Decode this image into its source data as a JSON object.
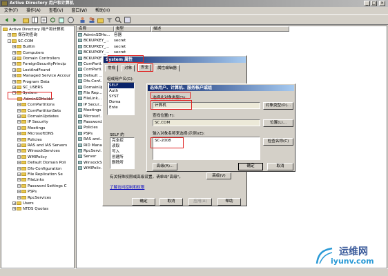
{
  "window": {
    "title": "Active Directory 用户和计算机",
    "controls": [
      "_",
      "□",
      "×"
    ]
  },
  "menu": [
    "文件(F)",
    "操作(A)",
    "查看(V)",
    "窗口(W)",
    "帮助(H)"
  ],
  "tree": {
    "items": [
      {
        "label": "Active Directory 用户和计算机",
        "indent": 0,
        "exp": ""
      },
      {
        "label": "保存的查询",
        "indent": 1,
        "exp": "+"
      },
      {
        "label": "SC.COM",
        "indent": 1,
        "exp": "-"
      },
      {
        "label": "Builtin",
        "indent": 2,
        "exp": "+"
      },
      {
        "label": "Computers",
        "indent": 2,
        "exp": "+"
      },
      {
        "label": "Domain Controllers",
        "indent": 2,
        "exp": "+"
      },
      {
        "label": "ForeignSecurityPrincip",
        "indent": 2,
        "exp": "+"
      },
      {
        "label": "LostAndFound",
        "indent": 2,
        "exp": "+"
      },
      {
        "label": "Managed Service Accour",
        "indent": 2,
        "exp": "+"
      },
      {
        "label": "Program Data",
        "indent": 2,
        "exp": "+"
      },
      {
        "label": "SC_USERS",
        "indent": 2,
        "exp": "+"
      },
      {
        "label": "System",
        "indent": 2,
        "exp": "-"
      },
      {
        "label": "AdminSDHolder",
        "indent": 3,
        "exp": ""
      },
      {
        "label": "ComPartitions",
        "indent": 3,
        "exp": "+"
      },
      {
        "label": "ComPartitionSets",
        "indent": 3,
        "exp": "+"
      },
      {
        "label": "DomainUpdates",
        "indent": 3,
        "exp": "+"
      },
      {
        "label": "IP Security",
        "indent": 3,
        "exp": "+"
      },
      {
        "label": "Meetings",
        "indent": 3,
        "exp": "+"
      },
      {
        "label": "MicrosoftDNS",
        "indent": 3,
        "exp": "+"
      },
      {
        "label": "Policies",
        "indent": 3,
        "exp": "+"
      },
      {
        "label": "RAS and IAS Servers",
        "indent": 3,
        "exp": "+"
      },
      {
        "label": "WinsockServices",
        "indent": 3,
        "exp": "+"
      },
      {
        "label": "WMIPolicy",
        "indent": 3,
        "exp": "+"
      },
      {
        "label": "Default Domain Poli",
        "indent": 3,
        "exp": "+"
      },
      {
        "label": "Dfs-Configuration",
        "indent": 3,
        "exp": "+"
      },
      {
        "label": "File Replication Se",
        "indent": 3,
        "exp": "+"
      },
      {
        "label": "FileLinks",
        "indent": 3,
        "exp": "+"
      },
      {
        "label": "Password Settings C",
        "indent": 3,
        "exp": "+"
      },
      {
        "label": "PSPs",
        "indent": 3,
        "exp": "+"
      },
      {
        "label": "RpcServices",
        "indent": 3,
        "exp": "+"
      },
      {
        "label": "Users",
        "indent": 2,
        "exp": "+"
      },
      {
        "label": "NTDS Quotas",
        "indent": 2,
        "exp": "+"
      }
    ]
  },
  "list": {
    "headers": [
      "名称",
      "类型",
      "描述"
    ],
    "rows": [
      {
        "name": "AdminSDHo...",
        "type": "容器"
      },
      {
        "name": "BCKUPKEY_...",
        "type": "secret"
      },
      {
        "name": "BCKUPKEY_...",
        "type": "secret"
      },
      {
        "name": "BCKUPKEY_...",
        "type": "secret"
      },
      {
        "name": "BCKUPKEY_...",
        "type": "secret"
      },
      {
        "name": "ComParti...",
        "type": ""
      },
      {
        "name": "ComParti...",
        "type": ""
      },
      {
        "name": "Default ...",
        "type": ""
      },
      {
        "name": "Dfs-Conf...",
        "type": ""
      },
      {
        "name": "DomainUpd...",
        "type": ""
      },
      {
        "name": "File Rep...",
        "type": ""
      },
      {
        "name": "FileLink...",
        "type": ""
      },
      {
        "name": "IP Secur...",
        "type": ""
      },
      {
        "name": "Meetings",
        "type": ""
      },
      {
        "name": "Microsof...",
        "type": ""
      },
      {
        "name": "Password...",
        "type": ""
      },
      {
        "name": "Policies",
        "type": ""
      },
      {
        "name": "PSPs",
        "type": ""
      },
      {
        "name": "RAS and...",
        "type": ""
      },
      {
        "name": "RID Mana...",
        "type": ""
      },
      {
        "name": "RpcServi...",
        "type": ""
      },
      {
        "name": "Server",
        "type": ""
      },
      {
        "name": "WinsockS...",
        "type": ""
      },
      {
        "name": "WMIPolic...",
        "type": ""
      }
    ]
  },
  "props": {
    "title": "System 属性",
    "tabs": [
      "常规",
      "对象",
      "安全",
      "属性编辑器"
    ],
    "group_label": "组或用户名(G):",
    "users": [
      "SELF",
      "Auth",
      "SYST",
      "Doma",
      "Ente"
    ],
    "perm_label": "SELF 的",
    "perms": [
      "完全控",
      "读取",
      "写入",
      "创建所",
      "删除所"
    ],
    "note": "有关特殊权限或高级设置，请单击\"高级\"。",
    "advanced": "高级(V)",
    "link": "了解访问控制和权限",
    "ok": "确定",
    "cancel": "取消",
    "apply": "应用(A)",
    "help": "帮助"
  },
  "select": {
    "title": "选择用户、计算机、服务帐户或组",
    "type_label": "选择此对象类型(S):",
    "type_value": "计算机",
    "type_btn": "对象类型(O)...",
    "loc_label": "查找位置(F):",
    "loc_value": "SC.COM",
    "loc_btn": "位置(L)...",
    "names_label": "输入对象名称来选择(示例)(E):",
    "names_value": "SC-2008",
    "check_btn": "检查名称(C)",
    "advanced": "高级(A)...",
    "ok": "确定",
    "cancel": "取消"
  },
  "watermark": {
    "cn": "运维网",
    "url": "iyunv.com"
  },
  "colors": {
    "dialog_title": "#0a246a",
    "highlight": "#e02020"
  }
}
